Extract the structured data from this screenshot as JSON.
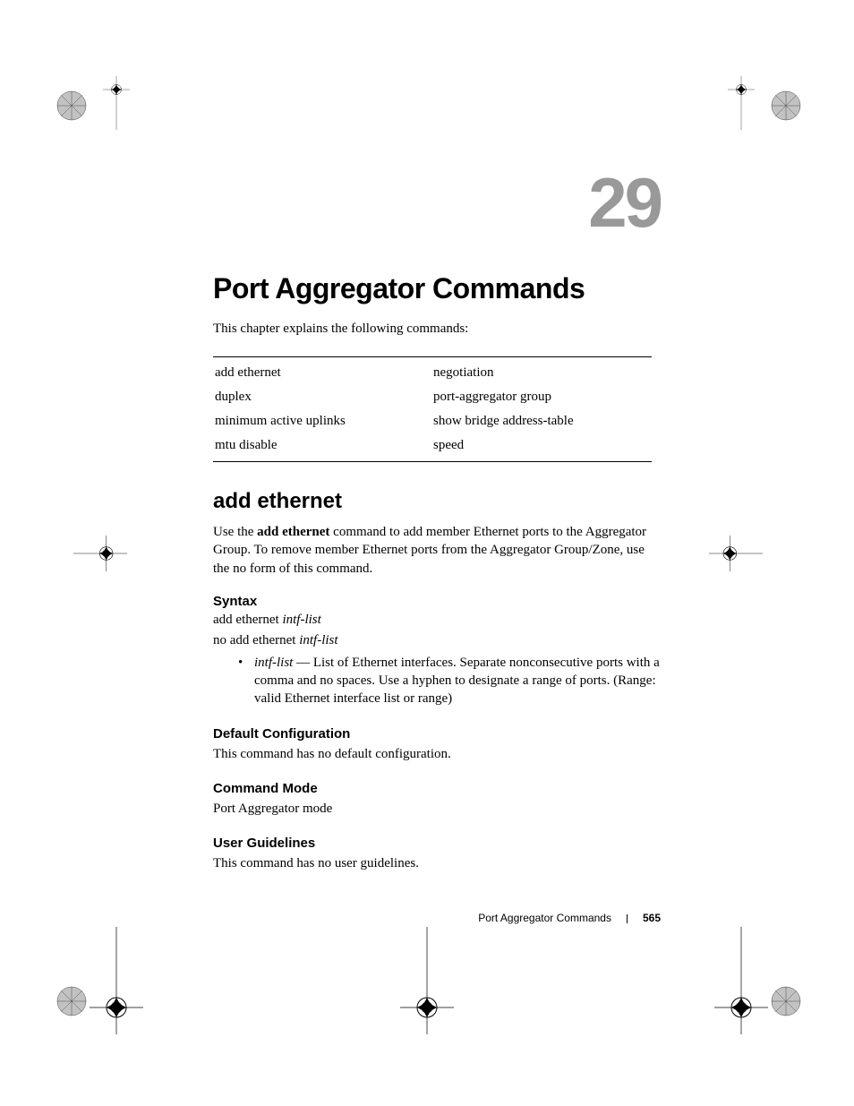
{
  "chapter": {
    "number": "29",
    "title": "Port Aggregator Commands",
    "intro": "This chapter explains the following commands:"
  },
  "command_table": {
    "rows": [
      {
        "left": "add ethernet",
        "right": "negotiation"
      },
      {
        "left": "duplex",
        "right": "port-aggregator group"
      },
      {
        "left": "minimum active uplinks",
        "right": "show bridge address-table"
      },
      {
        "left": "mtu disable",
        "right": "speed"
      }
    ]
  },
  "section": {
    "heading": "add ethernet",
    "desc_prefix": "Use the ",
    "desc_bold": "add ethernet",
    "desc_suffix": " command to add member Ethernet ports to the Aggregator Group. To remove member Ethernet ports from the Aggregator Group/Zone, use the no form of this command.",
    "syntax": {
      "label": "Syntax",
      "line1_cmd": "add ethernet ",
      "line1_arg": "intf-list",
      "line2_cmd": "no add ethernet ",
      "line2_arg": "intf-list",
      "bullet_arg": "intf-list",
      "bullet_text": " — List of Ethernet interfaces. Separate nonconsecutive ports with a comma and no spaces. Use a hyphen to designate a range of ports. (Range: valid Ethernet interface list or range)"
    },
    "default_config": {
      "label": "Default Configuration",
      "text": "This command has no default configuration."
    },
    "command_mode": {
      "label": "Command Mode",
      "text": "Port Aggregator mode"
    },
    "user_guidelines": {
      "label": "User Guidelines",
      "text": "This command has no user guidelines."
    }
  },
  "footer": {
    "title": "Port Aggregator Commands",
    "page": "565"
  }
}
